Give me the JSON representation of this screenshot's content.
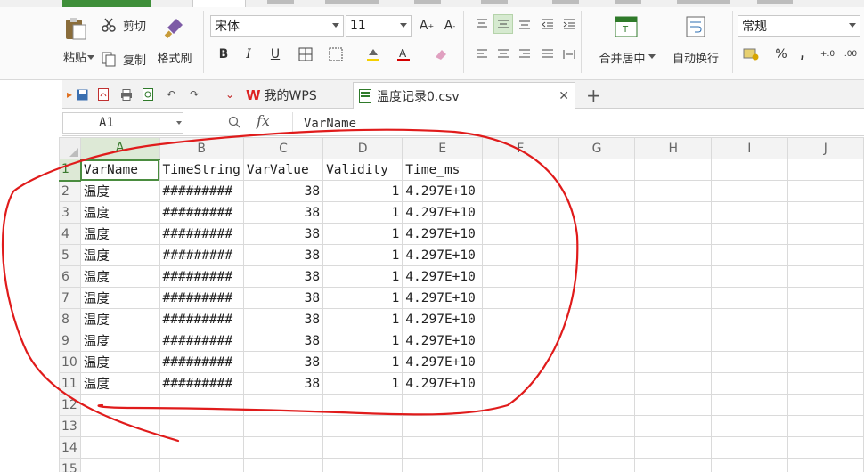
{
  "ribbon": {
    "cut": "剪切",
    "copy": "复制",
    "paste": "粘贴",
    "format_painter": "格式刷",
    "font_name": "宋体",
    "font_size": "11",
    "bold": "B",
    "italic": "I",
    "underline": "U",
    "merge_center": "合并居中",
    "wrap_text": "自动换行",
    "number_format": "常规",
    "percent": "%",
    "comma": ",",
    "inc_decimal": "+.0",
    "dec_decimal": ".00"
  },
  "doc_tabs": [
    {
      "label": "我的WPS"
    },
    {
      "label": "温度记录0.csv"
    }
  ],
  "formula_bar": {
    "name_box": "A1",
    "fx": "fx",
    "content": "VarName"
  },
  "columns": [
    "A",
    "B",
    "C",
    "D",
    "E",
    "F",
    "G",
    "H",
    "I",
    "J"
  ],
  "rows": [
    {
      "n": "1",
      "cells": [
        "VarName",
        "TimeString",
        "VarValue",
        "Validity",
        "Time_ms"
      ]
    },
    {
      "n": "2",
      "cells": [
        "温度",
        "#########",
        "38",
        "1",
        "4.297E+10"
      ]
    },
    {
      "n": "3",
      "cells": [
        "温度",
        "#########",
        "38",
        "1",
        "4.297E+10"
      ]
    },
    {
      "n": "4",
      "cells": [
        "温度",
        "#########",
        "38",
        "1",
        "4.297E+10"
      ]
    },
    {
      "n": "5",
      "cells": [
        "温度",
        "#########",
        "38",
        "1",
        "4.297E+10"
      ]
    },
    {
      "n": "6",
      "cells": [
        "温度",
        "#########",
        "38",
        "1",
        "4.297E+10"
      ]
    },
    {
      "n": "7",
      "cells": [
        "温度",
        "#########",
        "38",
        "1",
        "4.297E+10"
      ]
    },
    {
      "n": "8",
      "cells": [
        "温度",
        "#########",
        "38",
        "1",
        "4.297E+10"
      ]
    },
    {
      "n": "9",
      "cells": [
        "温度",
        "#########",
        "38",
        "1",
        "4.297E+10"
      ]
    },
    {
      "n": "10",
      "cells": [
        "温度",
        "#########",
        "38",
        "1",
        "4.297E+10"
      ]
    },
    {
      "n": "11",
      "cells": [
        "温度",
        "#########",
        "38",
        "1",
        "4.297E+10"
      ]
    },
    {
      "n": "12",
      "cells": [
        "",
        "",
        "",
        "",
        ""
      ]
    },
    {
      "n": "13",
      "cells": [
        "",
        "",
        "",
        "",
        ""
      ]
    },
    {
      "n": "14",
      "cells": [
        "",
        "",
        "",
        "",
        ""
      ]
    },
    {
      "n": "15",
      "cells": [
        "",
        "",
        "",
        "",
        ""
      ]
    }
  ],
  "colors": {
    "accent_green": "#4a8c3f",
    "annotation_red": "#e01b1b"
  }
}
